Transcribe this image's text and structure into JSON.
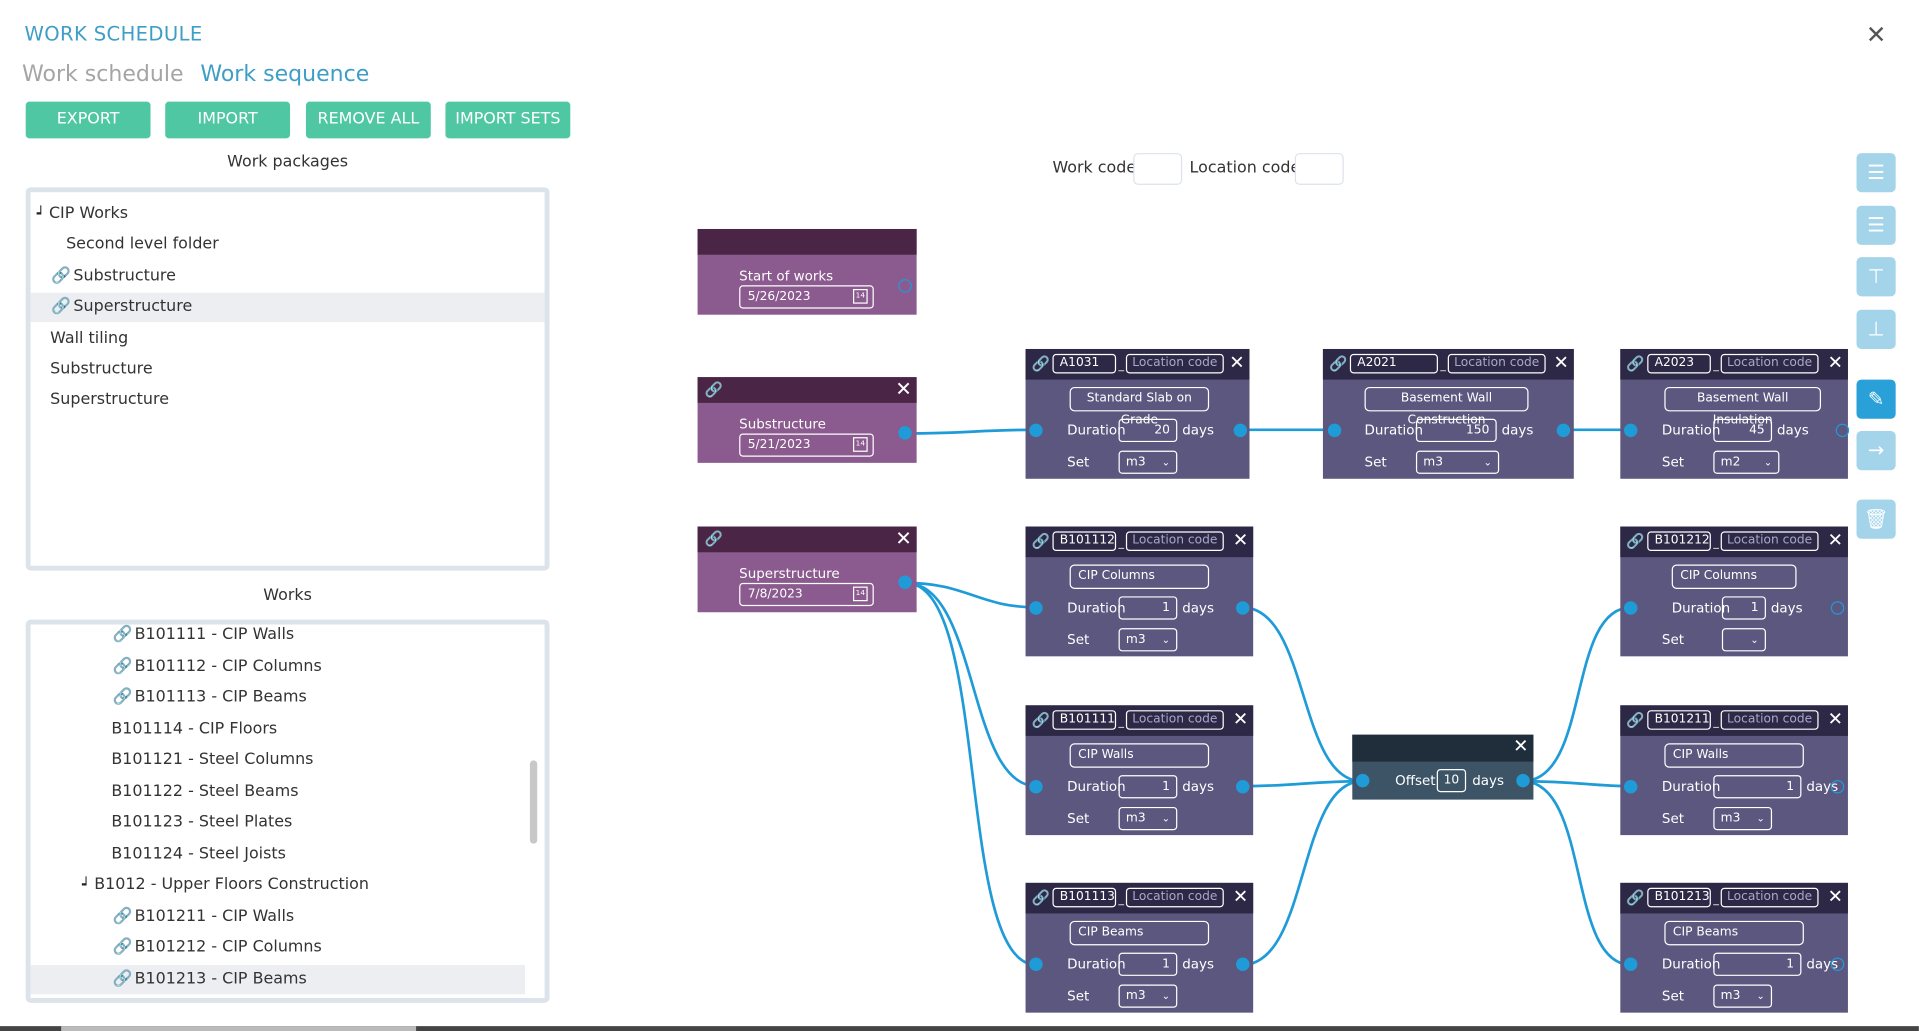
{
  "title": "WORK SCHEDULE",
  "tabs": [
    {
      "label": "Work schedule"
    },
    {
      "label": "Work sequence"
    }
  ],
  "toolbar": {
    "export": "EXPORT",
    "import": "IMPORT",
    "remove_all": "REMOVE ALL",
    "import_sets": "IMPORT SETS"
  },
  "work_packages": {
    "title": "Work packages",
    "items": [
      {
        "label": "CIP Works"
      },
      {
        "label": "Second level folder"
      },
      {
        "label": "Substructure"
      },
      {
        "label": "Superstructure"
      },
      {
        "label": "Wall tiling"
      },
      {
        "label": "Substructure"
      },
      {
        "label": "Superstructure"
      }
    ]
  },
  "works": {
    "title": "Works",
    "items": [
      {
        "label": "B101111 - CIP Walls"
      },
      {
        "label": "B101112 - CIP Columns"
      },
      {
        "label": "B101113 - CIP Beams"
      },
      {
        "label": "B101114 - CIP Floors"
      },
      {
        "label": "B101121 - Steel Columns"
      },
      {
        "label": "B101122 - Steel Beams"
      },
      {
        "label": "B101123 - Steel Plates"
      },
      {
        "label": "B101124 - Steel Joists"
      },
      {
        "label": "B1012 - Upper Floors Construction"
      },
      {
        "label": "B101211 - CIP Walls"
      },
      {
        "label": "B101212 - CIP Columns"
      },
      {
        "label": "B101213 - CIP Beams"
      }
    ]
  },
  "filters": {
    "work_code": "Work code",
    "location_code": "Location code"
  },
  "start_nodes": [
    {
      "label": "Start of works",
      "date": "5/26/2023"
    },
    {
      "label": "Substructure",
      "date": "5/21/2023"
    },
    {
      "label": "Superstructure",
      "date": "7/8/2023"
    }
  ],
  "common": {
    "location_placeholder": "Location code",
    "duration": "Duration",
    "days": "days",
    "set": "Set",
    "offset": "Offset",
    "cal": "14"
  },
  "work_nodes": [
    {
      "code": "A1031",
      "name": "Standard Slab on Grade",
      "duration": "20",
      "set": "m3"
    },
    {
      "code": "A2021",
      "name": "Basement Wall Construction",
      "duration": "150",
      "set": "m3"
    },
    {
      "code": "A2023",
      "name": "Basement Wall Insulation",
      "duration": "45",
      "set": "m2"
    },
    {
      "code": "B101112",
      "name": "CIP Columns",
      "duration": "1",
      "set": "m3"
    },
    {
      "code": "B101111",
      "name": "CIP Walls",
      "duration": "1",
      "set": "m3"
    },
    {
      "code": "B101113",
      "name": "CIP Beams",
      "duration": "1",
      "set": "m3"
    },
    {
      "code": "B101212",
      "name": "CIP Columns",
      "duration": "1",
      "set": ""
    },
    {
      "code": "B101211",
      "name": "CIP Walls",
      "duration": "1",
      "set": "m3"
    },
    {
      "code": "B101213",
      "name": "CIP Beams",
      "duration": "1",
      "set": "m3"
    }
  ],
  "offset_node": {
    "value": "10"
  },
  "icons": {
    "link": "link-icon",
    "close": "close-icon",
    "calendar": "calendar-icon",
    "chevron": "chevron-down-icon"
  },
  "colors": {
    "accent": "#3f9ec6",
    "button": "#4fc7a2",
    "wire": "#1f9bd8",
    "work_node": "#5c577e",
    "start_node": "#8b5a8e"
  }
}
